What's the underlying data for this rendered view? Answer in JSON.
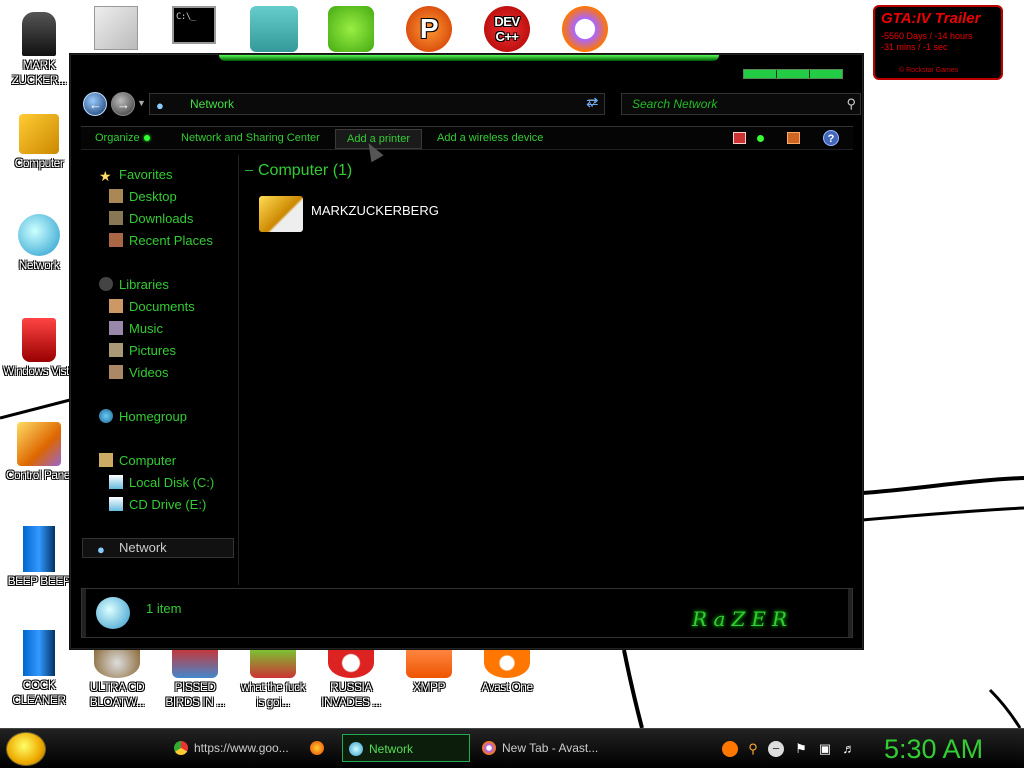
{
  "desktop": {
    "top_icons": [
      {
        "name": "documents-icon"
      },
      {
        "name": "cmd-icon"
      },
      {
        "name": "server-icon"
      },
      {
        "name": "bad-piggies-icon"
      },
      {
        "name": "p-app-icon"
      },
      {
        "name": "dev-cpp-icon",
        "text": "DEV C++"
      },
      {
        "name": "avast-vpn-icon"
      }
    ],
    "left_icons": [
      {
        "label": "MARK ZUCKER..."
      },
      {
        "label": "Computer"
      },
      {
        "label": "Network"
      },
      {
        "label": "Windows Vista"
      },
      {
        "label": "Control Panel"
      },
      {
        "label": "BEEP BEEP"
      },
      {
        "label": "COCK CLEANER"
      }
    ],
    "bottom_icons": [
      {
        "label": "ULTRA CD BLOATW..."
      },
      {
        "label": "PISSED BIRDS IN ..."
      },
      {
        "label": "what the fuck is goi..."
      },
      {
        "label": "RUSSIA INVADES ..."
      },
      {
        "label": "XMPP"
      },
      {
        "label": "Avast One"
      }
    ]
  },
  "gta_widget": {
    "title": "GTA:IV  Trailer",
    "line1": "-5560 Days / -14 hours",
    "line2": "-31 mins / -1 sec",
    "copyright": "©  Rockstar Games"
  },
  "explorer": {
    "address": "Network",
    "search_placeholder": "Search Network",
    "toolbar": {
      "organize": "Organize",
      "network_sharing": "Network and Sharing Center",
      "add_printer": "Add a printer",
      "add_wireless": "Add a wireless device"
    },
    "help": "?",
    "sidebar": {
      "favorites": "Favorites",
      "desktop": "Desktop",
      "downloads": "Downloads",
      "recent": "Recent Places",
      "libraries": "Libraries",
      "documents": "Documents",
      "music": "Music",
      "pictures": "Pictures",
      "videos": "Videos",
      "homegroup": "Homegroup",
      "computer": "Computer",
      "local_disk": "Local Disk (C:)",
      "cd_drive": "CD Drive (E:)",
      "network": "Network"
    },
    "group_header": "Computer (1)",
    "item": "MARKZUCKERBERG",
    "status": "1 item",
    "brand": "RaZER"
  },
  "taskbar": {
    "tasks": [
      {
        "label": "https://www.goo..."
      },
      {
        "label": "Network"
      },
      {
        "label": "New Tab - Avast..."
      }
    ],
    "clock": "5:30 AM"
  },
  "colors": {
    "accent": "#33cc33",
    "window_bg": "#000000",
    "link": "#33cc33"
  }
}
